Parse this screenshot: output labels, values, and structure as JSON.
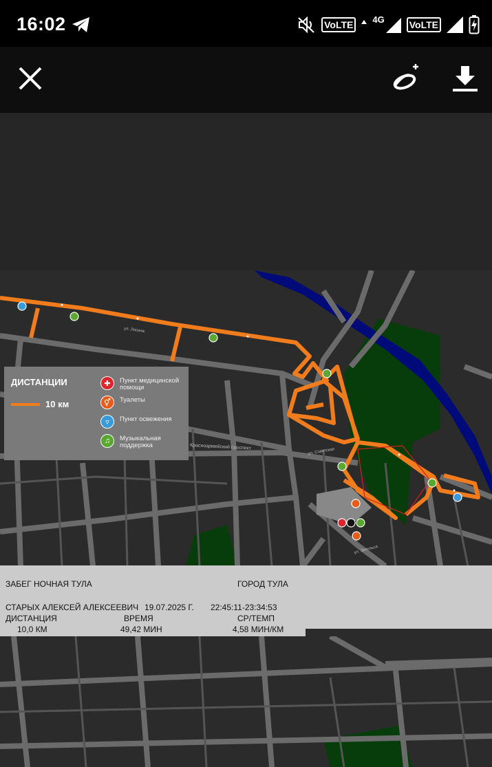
{
  "status_bar": {
    "time": "16:02",
    "volte_1": "VoLTE",
    "network_type": "4G",
    "volte_2": "VoLTE"
  },
  "toolbar": {
    "icons": [
      "close-icon",
      "share-add-icon",
      "download-icon"
    ]
  },
  "map": {
    "street_labels": [
      "ул. Лосина",
      "Красноармейский проспект",
      "ул. Советская",
      "ул. Энгельса"
    ],
    "colors": {
      "route": "#f07c1e",
      "river": "#000a78",
      "park": "#063d0a",
      "road": "#6b6b6b"
    }
  },
  "legend": {
    "title": "ДИСТАНЦИИ",
    "distance": "10 км",
    "items": [
      {
        "icon": "medical-cross-icon",
        "label": "Пункт медицинской помощи",
        "color": "#e0242c"
      },
      {
        "icon": "toilet-icon",
        "label": "Туалеты",
        "color": "#e85c1a"
      },
      {
        "icon": "water-cup-icon",
        "label": "Пункт освежения",
        "color": "#3a9ad9"
      },
      {
        "icon": "music-note-icon",
        "label": "Музыкальная поддержка",
        "color": "#5aa832"
      }
    ]
  },
  "results": {
    "event": "ЗАБЕГ НОЧНАЯ ТУЛА",
    "city": "ГОРОД ТУЛА",
    "runner": "СТАРЫХ АЛЕКСЕЙ АЛЕКСЕЕВИЧ",
    "date": "19.07.2025 Г.",
    "time_range": "22:45:11-23:34:53",
    "distance_label": "ДИСТАНЦИЯ",
    "time_label": "ВРЕМЯ",
    "pace_label": "СР/ТЕМП",
    "distance_value": "10,0 КМ",
    "time_value": "49,42 МИН",
    "pace_value": "4,58 МИН/КМ"
  }
}
